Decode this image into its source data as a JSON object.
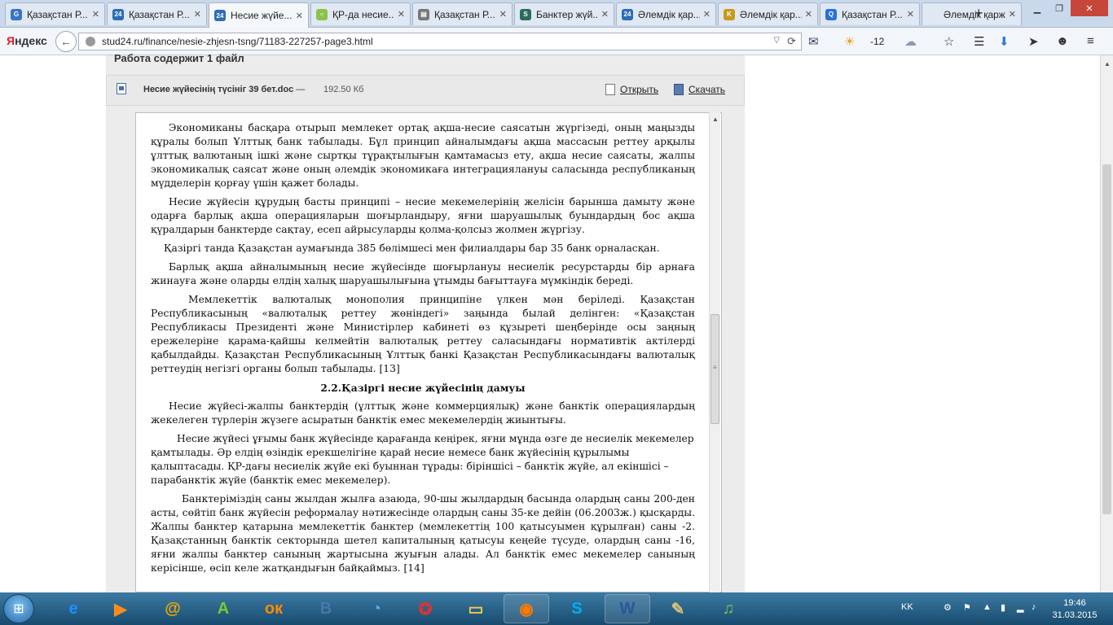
{
  "browser": {
    "tabs": [
      {
        "title": "Қазақстан Р...",
        "fav_color": "#3a75c4",
        "fav_glyph": "G"
      },
      {
        "title": "Қазақстан Р...",
        "fav_color": "#2d6db5",
        "fav_glyph": "24"
      },
      {
        "title": "Несие жүйе...",
        "fav_color": "#2d6db5",
        "fav_glyph": "24",
        "active": true
      },
      {
        "title": "ҚР-да несие...",
        "fav_color": "#8bc34a",
        "fav_glyph": "○"
      },
      {
        "title": "Қазақстан Р...",
        "fav_color": "#777777",
        "fav_glyph": "▤"
      },
      {
        "title": "Банктер жүй...",
        "fav_color": "#2b6b5e",
        "fav_glyph": "S"
      },
      {
        "title": "Әлемдік қар...",
        "fav_color": "#2d6db5",
        "fav_glyph": "24"
      },
      {
        "title": "Әлемдік қар...",
        "fav_color": "#c79a1b",
        "fav_glyph": "K"
      },
      {
        "title": "Қазақстан Р...",
        "fav_color": "#2a6fd6",
        "fav_glyph": "Q"
      },
      {
        "title": "Әлемдік қаржы ...",
        "fav_color": "#dfe8f3",
        "fav_glyph": ""
      }
    ],
    "new_tab": "+",
    "window_controls": {
      "minimize": "▁",
      "maximize": "❐",
      "close": "✕"
    },
    "logo_prefix": "Я",
    "logo_rest": "ндекс",
    "url": "stud24.ru/finance/nesie-zhjesn-tsng/71183-227257-page3.html",
    "weather_temp": "-12"
  },
  "page": {
    "cut_title": "Работа содержит 1 файл",
    "file_name": "Несие жүйесінің түсініг 39 бет.doc",
    "file_dash": "—",
    "file_size": "192.50 Кб",
    "open_label": "Открыть",
    "download_label": "Скачать",
    "top_strip": "..... ...... ...... ......",
    "paragraphs": [
      "Экономиканы басқара отырып мемлекет ортақ ақша-несие  саясатын жүргізеді, оның маңызды құралы болып Ұлттық банк табылады. Бұл принцип  айналымдағы ақша массасын реттеу арқылы ұлттық валютаның ішкі және сыртқы тұрақтылығын қамтамасыз ету, ақша несие саясаты, жалпы экономикалық саясат және оның әлемдік экономикаға интеграциялануы саласында республиканың мүдделерін қорғау үшін қажет болады.",
      "Несие жүйесін құрудың басты принципі – несие мекемелерінің желісін  барынша дамыту және одарға барлық ақша операцияларын  шоғырландыру, яғни шаруашылық буындардың бос ақша қүралдарын банктерде сақтау, есеп айрысуларды қолма-қолсыз жолмен жүргізу.",
      "Қазіргі танда Қазақстан аумағында 385 бөлімшесі  мен филиалдары бар 35 банк орналасқан.",
      "Барлық  ақша айналымының несие жүйесінде  шоғырлануы несиелік ресурстарды бір  арнаға жинауға және оларды елдің  халық шаруашылығына ұтымды бағыттауға мүмкіндік береді.",
      "Мемлекеттік валюталық монополия принципіне үлкен мән беріледі. Қазақстан Республикасының «валюталық реттеу жөніндегі» заңында былай делінген: «Қазақстан Республикасы Президенті және Министірлер кабинеті өз құзыреті шеңберінде осы заңның ережелеріне қарама-қайшы келмейтін валюталық реттеу саласындағы нормативтік актілерді қабылдайды. Қазақстан Республикасының Ұлттық банкі Қазақстан Республикасындағы валюталық реттеудің негізгі органы болып табылады. [13]"
    ],
    "heading": "2.2.Қазіргі  несие жүйесінің дамуы",
    "paragraphs2": [
      "Несие жүйесі-жалпы банктердің (ұлттық және коммерциялық) және банктік операциялардың жекелеген түрлерін жүзеге асыратын банктік емес мекемелердің  жиынтығы.",
      "Несие жүйесі ұғымы банк жүйесінде қарағанда кеңірек, яғни мұнда өзге де несиелік мекемелер қамтылады. Әр елдің өзіндік ерекшелігіне қарай несие немесе  банк жүйесінің құрылымы қалыптасады. ҚР-дағы несиелік жүйе екі буыннан тұрады: біріншісі – банктік жүйе, ал екіншісі – парабанктік жүйе (банктік емес мекемелер).",
      "Банктеріміздің саны жылдан жылға азаюда, 90-шы жылдардың басында олардың саны 200-ден асты, сөйтіп банк жүйесін реформалау нәтижесінде олардың саны 35-ке дейін (06.2003ж.) қысқарды. Жалпы банктер қатарына мемлекеттік банктер (мемлекеттің 100 қатысуымен құрылған) саны -2. Қазақстанның банктік секторында шетел капиталының қатысуы кеңейе түсуде, олардың саны -16, яғни жалпы банктер санының жартысына жуығын алады. Ал банктік емес мекемелер санының керісінше, өсіп келе жатқандығын байқаймыз. [14]"
    ]
  },
  "taskbar": {
    "apps": [
      {
        "name": "ie",
        "glyph": "e",
        "color": "#1e90ff"
      },
      {
        "name": "media",
        "glyph": "▶",
        "color": "#ff8c1a"
      },
      {
        "name": "mail",
        "glyph": "@",
        "color": "#f2a900"
      },
      {
        "name": "agent",
        "glyph": "A",
        "color": "#7ec832"
      },
      {
        "name": "ok",
        "glyph": "ок",
        "color": "#ff8a00"
      },
      {
        "name": "vk",
        "glyph": "В",
        "color": "#4a76a8"
      },
      {
        "name": "chrome-alt",
        "glyph": "◔",
        "color": "#4fb3ff"
      },
      {
        "name": "ccleaner",
        "glyph": "✪",
        "color": "#d33"
      },
      {
        "name": "explorer",
        "glyph": "▭",
        "color": "#f3c74b"
      },
      {
        "name": "firefox",
        "glyph": "◉",
        "color": "#ff7b00"
      },
      {
        "name": "skype",
        "glyph": "S",
        "color": "#00aff0"
      },
      {
        "name": "word",
        "glyph": "W",
        "color": "#2b5797"
      },
      {
        "name": "paint",
        "glyph": "✎",
        "color": "#d9c27a"
      },
      {
        "name": "music",
        "glyph": "♫",
        "color": "#7ac143"
      }
    ],
    "lang": "KK",
    "time": "19:46",
    "date": "31.03.2015"
  }
}
